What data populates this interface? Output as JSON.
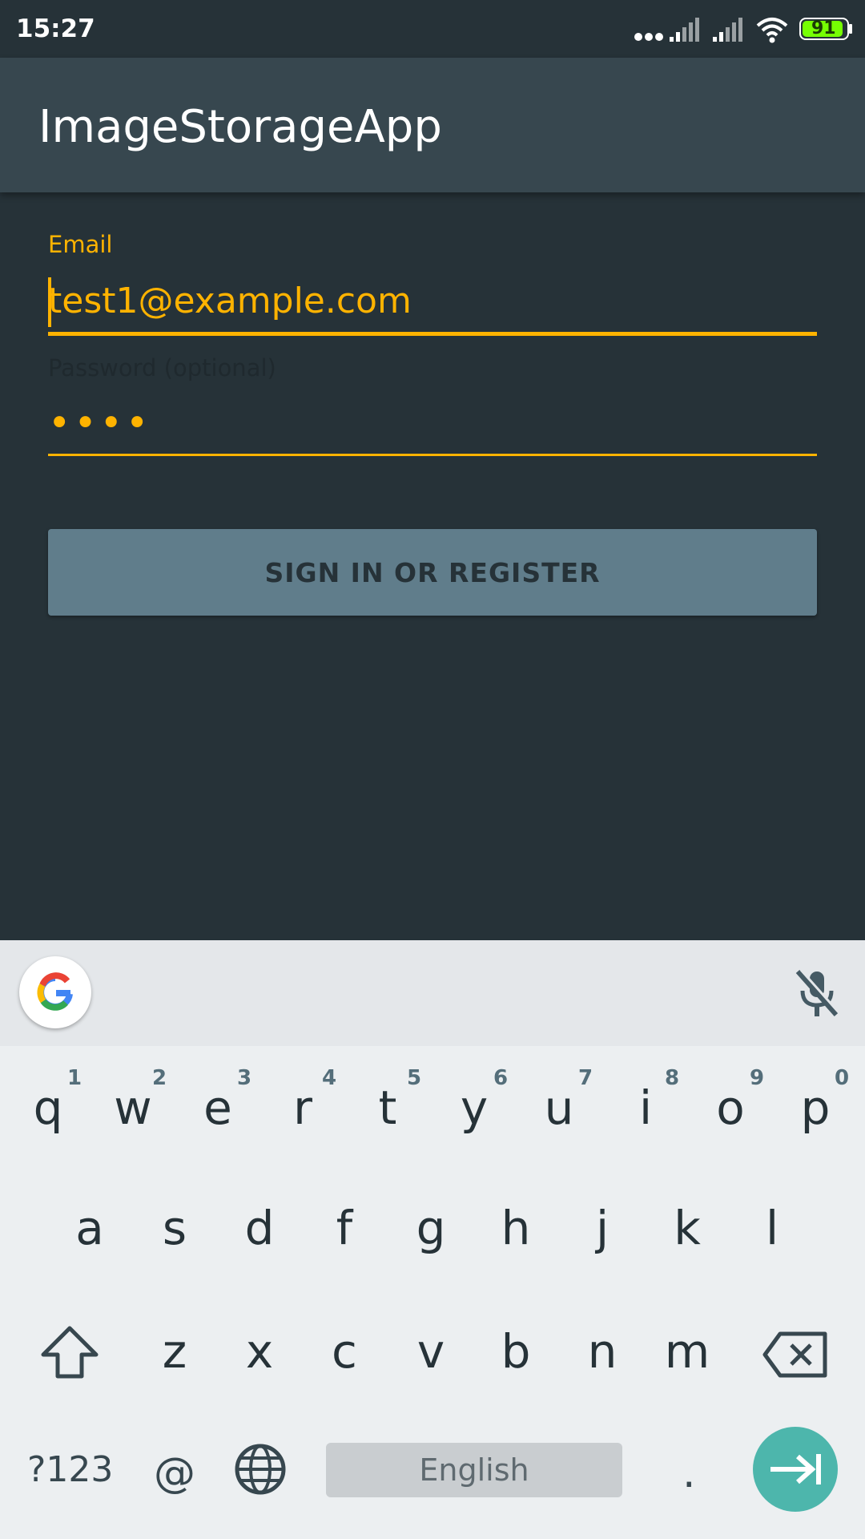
{
  "status": {
    "time": "15:27",
    "battery": "91"
  },
  "appbar": {
    "title": "ImageStorageApp"
  },
  "form": {
    "email_label": "Email",
    "email_value": "test1@example.com",
    "password_label": "Password (optional)",
    "password_value": "••••",
    "submit_label": "SIGN IN OR REGISTER"
  },
  "keyboard": {
    "row1": [
      "q",
      "w",
      "e",
      "r",
      "t",
      "y",
      "u",
      "i",
      "o",
      "p"
    ],
    "row1_hints": [
      "1",
      "2",
      "3",
      "4",
      "5",
      "6",
      "7",
      "8",
      "9",
      "0"
    ],
    "row2": [
      "a",
      "s",
      "d",
      "f",
      "g",
      "h",
      "j",
      "k",
      "l"
    ],
    "row3": [
      "z",
      "x",
      "c",
      "v",
      "b",
      "n",
      "m"
    ],
    "symbols_label": "?123",
    "at_label": "@",
    "space_label": "English",
    "period_label": ".",
    "accent_color": "#4db6ac"
  },
  "colors": {
    "accent": "#ffb300",
    "background": "#263238",
    "appbar": "#37474f",
    "button": "#607d8b"
  }
}
